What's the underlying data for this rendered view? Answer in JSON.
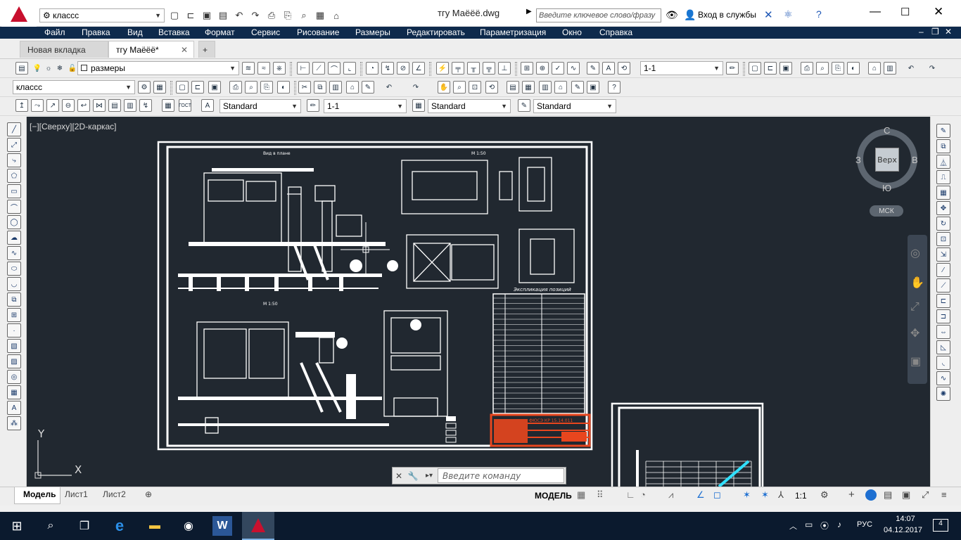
{
  "title_bar": {
    "workspace": "классс",
    "document_title": "тгу Маёёё.dwg",
    "search_placeholder": "Введите ключевое слово/фразу",
    "login_label": "Вход в службы"
  },
  "menu": [
    "Файл",
    "Правка",
    "Вид",
    "Вставка",
    "Формат",
    "Сервис",
    "Рисование",
    "Размеры",
    "Редактировать",
    "Параметризация",
    "Окно",
    "Справка"
  ],
  "file_tabs": [
    {
      "label": "Новая вкладка",
      "active": false
    },
    {
      "label": "тгу Маёёё*",
      "active": true
    }
  ],
  "toolbar": {
    "layer_name": "размеры",
    "scale_combo": "1-1",
    "workspace_combo": "классс",
    "text_style": "Standard",
    "dim_scale": "1-1",
    "table_style": "Standard",
    "multileader_style": "Standard"
  },
  "viewport": {
    "view_label": "[−][Сверху][2D-каркас]",
    "viewcube": {
      "north": "С",
      "south": "Ю",
      "west": "З",
      "east": "В",
      "face": "Верх",
      "ucs": "МСК"
    },
    "ucs_x": "X",
    "ucs_y": "Y",
    "drawing_texts": [
      "Вид в плане",
      "М 1:50",
      "Экспликация позиций",
      "М 1:50",
      "ФЮСЭ КР 15.14.011"
    ]
  },
  "command_line": {
    "placeholder": "Введите команду"
  },
  "layout_tabs": [
    "Модель",
    "Лист1",
    "Лист2"
  ],
  "status_bar": {
    "mode": "МОДЕЛЬ",
    "scale": "1:1"
  },
  "taskbar": {
    "time": "14:07",
    "date": "04.12.2017",
    "lang": "РУС",
    "notifications": "4"
  },
  "colors": {
    "canvas": "#212830",
    "menubar": "#0e2a4c",
    "accent": "#c8102e",
    "title_block": "#e8461e"
  }
}
